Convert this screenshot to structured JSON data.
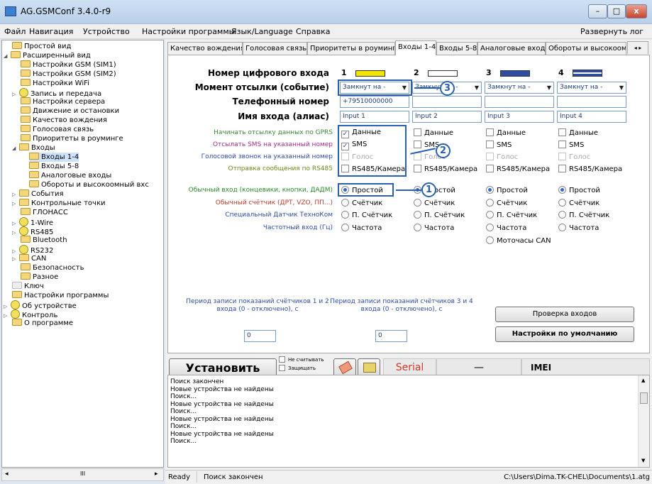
{
  "window": {
    "title": "AG.GSMConf 3.4.0-r9",
    "minimize": "–",
    "maximize": "□",
    "close": "x"
  },
  "menu": {
    "items": [
      "Файл",
      "Навигация",
      "Устройство",
      "Настройки программы",
      "Язык/Language",
      "Справка"
    ],
    "expand_log": "Развернуть лог"
  },
  "tree": {
    "items": [
      "Простой вид",
      "Расширенный вид",
      "Настройки GSM (SIM1)",
      "Настройки GSM (SIM2)",
      "Настройки WiFi",
      "Запись и передача",
      "Настройки сервера",
      "Движение и остановки",
      "Качество вождения",
      "Голосовая связь",
      "Приоритеты в роуминге",
      "Входы",
      "Входы 1-4",
      "Входы 5-8",
      "Аналоговые входы",
      "Обороты и высокоомный вхс",
      "События",
      "Контрольные точки",
      "ГЛОНАСС",
      "1-Wire",
      "RS485",
      "Bluetooth",
      "RS232",
      "CAN",
      "Безопасность",
      "Разное",
      "Ключ",
      "Настройки программы",
      "Об устройстве",
      "Контроль",
      "О программе"
    ],
    "scroll_mark": "III"
  },
  "tabs": [
    "Качество вождения",
    "Голосовая связь",
    "Приоритеты в роуминге",
    "Входы 1-4",
    "Входы 5-8",
    "Аналоговые входы",
    "Обороты и высокоомн"
  ],
  "form": {
    "row_labels": {
      "input_number": "Номер цифрового входа",
      "send_moment": "Момент отсылки (событие)",
      "phone": "Телефонный номер",
      "alias": "Имя входа (алиас)"
    },
    "option_labels": {
      "gprs": "Начинать отсылку данных по GPRS",
      "sms": "Отсылать SMS на указанный номер",
      "voice": "Голосовой звонок на указанный номер",
      "rs485": "Отправка сообщения по RS485"
    },
    "mode_labels": {
      "normal": "Обычный вход (концевики, кнопки, ДАДМ)",
      "counter": "Обычный счётчик (ДРТ, VZO, ПП...)",
      "special": "Специальный Датчик ТехноКом",
      "freq": "Частотный вход (Гц)"
    },
    "columns": [
      {
        "num": "1",
        "color": "#f2e600",
        "event": "Замкнут на -",
        "phone": "+79510000000",
        "alias": "Input 1",
        "data": "Данные",
        "sms": "SMS",
        "voice": "Голос",
        "rs485": "RS485/Камера",
        "normal": "Простой",
        "counter": "Счётчик",
        "special": "П. Счётчик",
        "freq": "Частота"
      },
      {
        "num": "2",
        "color": "#ffffff",
        "event": "Замкнут на -",
        "phone": "",
        "alias": "Input 2",
        "data": "Данные",
        "sms": "SMS",
        "voice": "Голос",
        "rs485": "RS485/Камера",
        "normal": "Простой",
        "counter": "Счётчик",
        "special": "П. Счётчик",
        "freq": "Частота"
      },
      {
        "num": "3",
        "color": "#2b4ea3",
        "event": "Замкнут на -",
        "phone": "",
        "alias": "Input 3",
        "data": "Данные",
        "sms": "SMS",
        "voice": "Голос",
        "rs485": "RS485/Камера",
        "normal": "Простой",
        "counter": "Счётчик",
        "special": "П. Счётчик",
        "freq": "Частота",
        "extra": "Моточасы CAN"
      },
      {
        "num": "4",
        "color": "#2b4ea3",
        "event": "Замкнут на -",
        "phone": "",
        "alias": "Input 4",
        "data": "Данные",
        "sms": "SMS",
        "voice": "Голос",
        "rs485": "RS485/Камера",
        "normal": "Простой",
        "counter": "Счётчик",
        "special": "П. Счётчик",
        "freq": "Частота"
      }
    ],
    "period12_label": "Период записи показаний счётчиков 1 и 2 входа (0 - отключено), с",
    "period34_label": "Период записи показаний счётчиков 3 и 4 входа (0 - отключено), с",
    "period12_value": "0",
    "period34_value": "0",
    "check_inputs": "Проверка входов",
    "defaults": "Настройки по умолчанию",
    "callouts": [
      "1",
      "2",
      "3"
    ],
    "check_mark": "✓"
  },
  "toolbar": {
    "install": "Установить",
    "no_read": "Не считывать",
    "protect": "Защищать",
    "serial": "Serial",
    "dash": "—",
    "imei": "IMEI"
  },
  "log": {
    "lines": [
      "Поиск закончен",
      "Новые устройства не найдены",
      "Поиск...",
      "Новые устройства не найдены",
      "Поиск...",
      "Новые устройства не найдены",
      "Поиск...",
      "Новые устройства не найдены",
      "Поиск..."
    ]
  },
  "status": {
    "ready": "Ready",
    "message": "Поиск закончен",
    "path": "C:\\Users\\Dima.TK-CHEL\\Documents\\1.atg"
  },
  "colors": {
    "accent": "#2a5fb3",
    "serial_red": "#d23a2a"
  }
}
